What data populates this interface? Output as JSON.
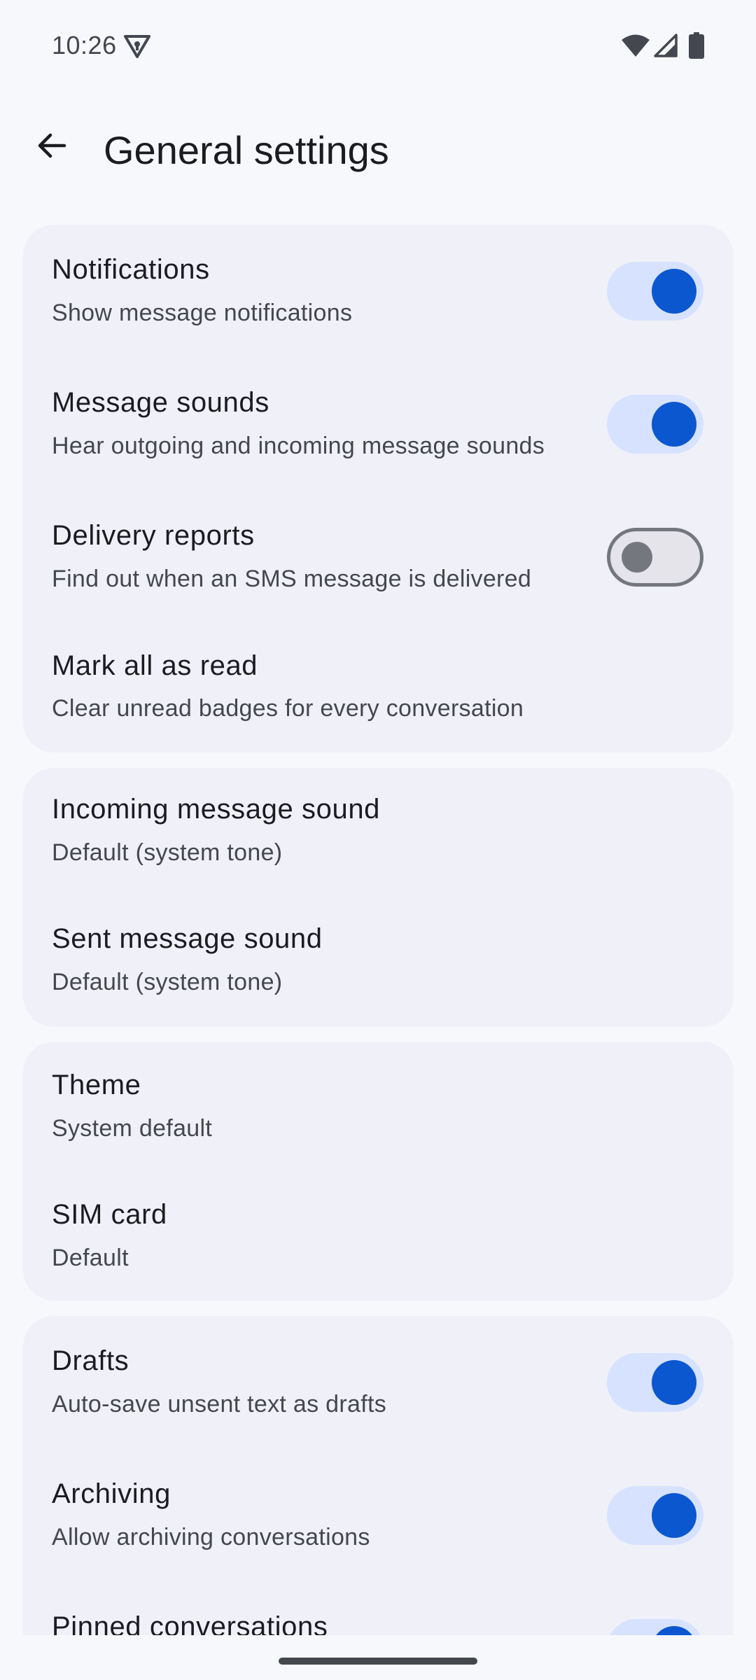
{
  "status_bar": {
    "time": "10:26",
    "icons": [
      "vpn-key-icon",
      "wifi-icon",
      "cellular-signal-icon",
      "battery-icon"
    ]
  },
  "app_bar": {
    "back_icon": "arrow-back-icon",
    "title": "General settings"
  },
  "colors": {
    "background": "#f7f8fc",
    "card": "#f0f1f8",
    "accent": "#0b57d0",
    "toggle_track_on": "#d6e2ff",
    "toggle_off_outline": "#75777f"
  },
  "settings": {
    "notifications": {
      "title": "Notifications",
      "subtitle": "Show message notifications",
      "enabled": true
    },
    "message_sounds": {
      "title": "Message sounds",
      "subtitle": "Hear outgoing and incoming message sounds",
      "enabled": true
    },
    "delivery_reports": {
      "title": "Delivery reports",
      "subtitle": "Find out when an SMS message is delivered",
      "enabled": false
    },
    "mark_all_read": {
      "title": "Mark all as read",
      "subtitle": "Clear unread badges for every conversation"
    },
    "incoming_sound": {
      "title": "Incoming message sound",
      "subtitle": "Default (system tone)"
    },
    "sent_sound": {
      "title": "Sent message sound",
      "subtitle": "Default (system tone)"
    },
    "theme": {
      "title": "Theme",
      "subtitle": "System default"
    },
    "sim_card": {
      "title": "SIM card",
      "subtitle": "Default"
    },
    "drafts": {
      "title": "Drafts",
      "subtitle": "Auto-save unsent text as drafts",
      "enabled": true
    },
    "archiving": {
      "title": "Archiving",
      "subtitle": "Allow archiving conversations",
      "enabled": true
    },
    "pinned": {
      "title": "Pinned conversations",
      "enabled": true
    }
  }
}
